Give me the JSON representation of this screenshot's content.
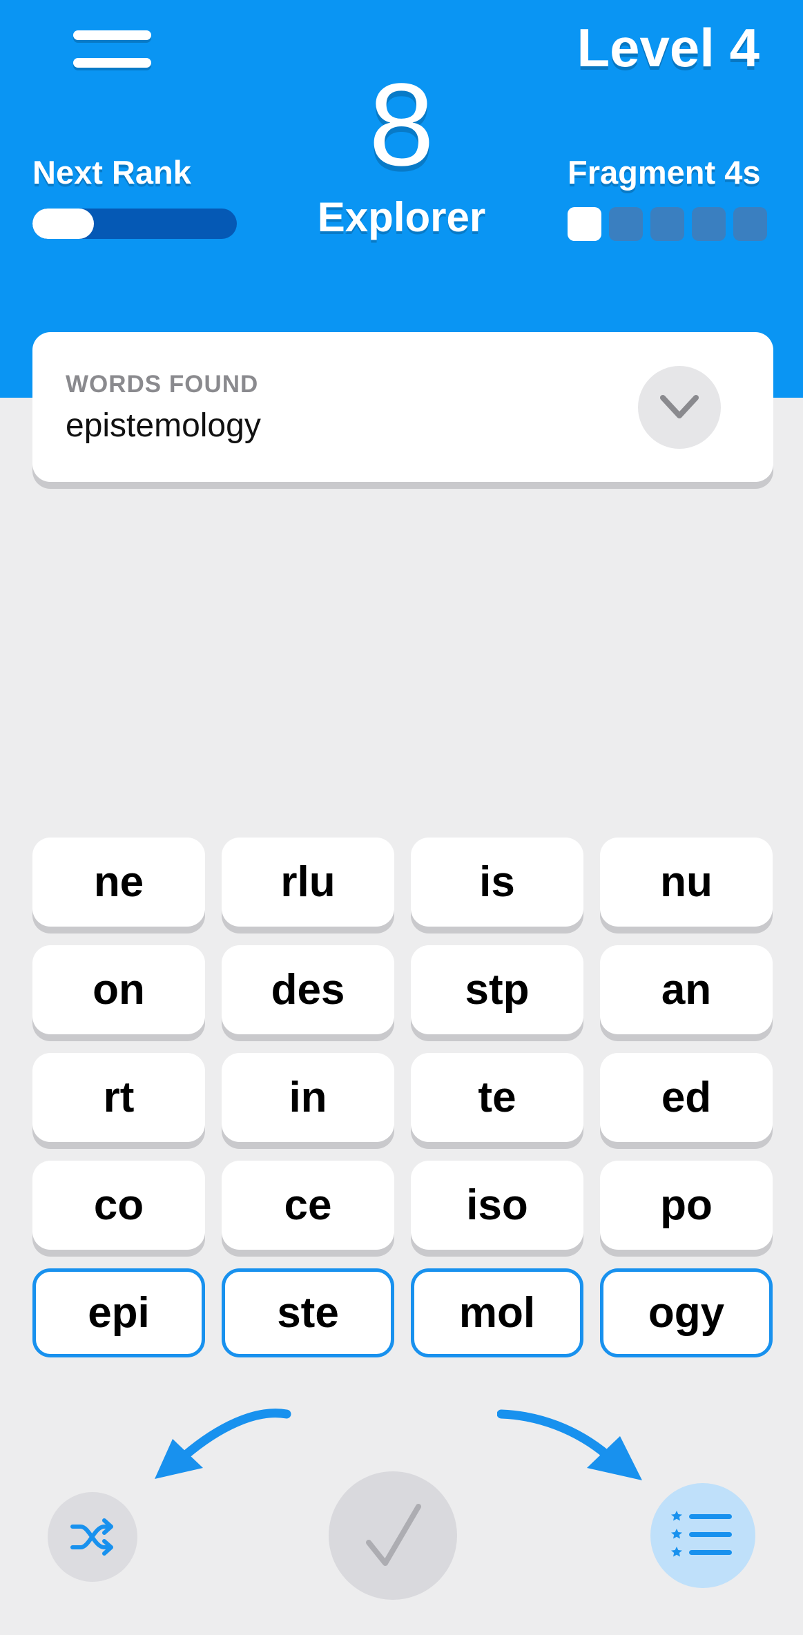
{
  "header": {
    "level": "Level 4",
    "score": "8",
    "rank": "Explorer",
    "next_rank_label": "Next Rank",
    "next_rank_progress": 0.3,
    "fragment_label": "Fragment 4s",
    "fragment_pips_total": 5,
    "fragment_pips_filled": 1,
    "background_color": "#0a95f3"
  },
  "words_panel": {
    "title": "WORDS FOUND",
    "words": "epistemology",
    "expand_icon": "chevron-down-icon"
  },
  "tiles": [
    {
      "text": "ne",
      "selected": false
    },
    {
      "text": "rlu",
      "selected": false
    },
    {
      "text": "is",
      "selected": false
    },
    {
      "text": "nu",
      "selected": false
    },
    {
      "text": "on",
      "selected": false
    },
    {
      "text": "des",
      "selected": false
    },
    {
      "text": "stp",
      "selected": false
    },
    {
      "text": "an",
      "selected": false
    },
    {
      "text": "rt",
      "selected": false
    },
    {
      "text": "in",
      "selected": false
    },
    {
      "text": "te",
      "selected": false
    },
    {
      "text": "ed",
      "selected": false
    },
    {
      "text": "co",
      "selected": false
    },
    {
      "text": "ce",
      "selected": false
    },
    {
      "text": "iso",
      "selected": false
    },
    {
      "text": "po",
      "selected": false
    },
    {
      "text": "epi",
      "selected": true
    },
    {
      "text": "ste",
      "selected": true
    },
    {
      "text": "mol",
      "selected": true
    },
    {
      "text": "ogy",
      "selected": true
    }
  ],
  "controls": {
    "shuffle_icon": "shuffle-icon",
    "submit_icon": "checkmark-icon",
    "list_icon": "ranked-list-icon",
    "accent_color": "#1891ee"
  }
}
